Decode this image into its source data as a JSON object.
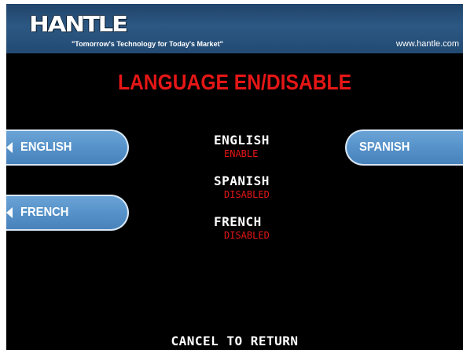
{
  "header": {
    "logo_text": "HANTLE",
    "tagline": "\"Tomorrow's Technology for Today's Market\"",
    "website": "www.hantle.com"
  },
  "screen": {
    "title": "LANGUAGE EN/DISABLE"
  },
  "buttons": {
    "left": [
      {
        "label": "ENGLISH"
      },
      {
        "label": "FRENCH"
      }
    ],
    "right": [
      {
        "label": "SPANISH"
      }
    ]
  },
  "languages": [
    {
      "name": "ENGLISH",
      "status": "ENABLE"
    },
    {
      "name": "SPANISH",
      "status": "DISABLED"
    },
    {
      "name": "FRENCH",
      "status": "DISABLED"
    }
  ],
  "footer": {
    "prompt": "CANCEL TO RETURN"
  },
  "colors": {
    "background": "#000000",
    "header": "#2c5883",
    "title": "#e51616",
    "status": "#e51616",
    "button": "#5692c9"
  }
}
